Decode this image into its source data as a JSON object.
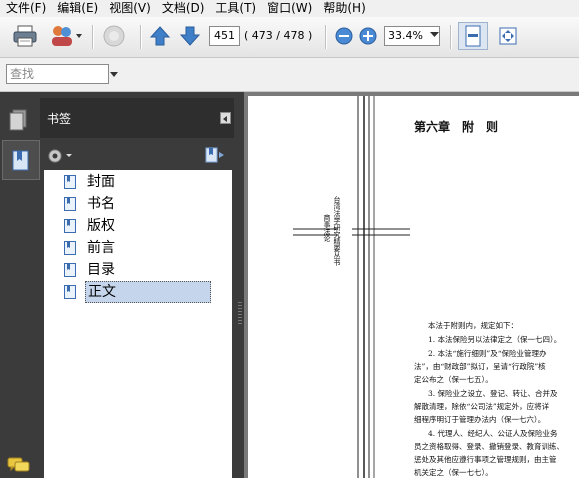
{
  "menu": [
    "文件(F)",
    "编辑(E)",
    "视图(V)",
    "文档(D)",
    "工具(T)",
    "窗口(W)",
    "帮助(H)"
  ],
  "toolbar": {
    "current_page": "451",
    "page_count": "( 473 / 478 )",
    "zoom": "33.4%"
  },
  "find": {
    "placeholder": "查找"
  },
  "sidebar": {
    "title": "书签",
    "bookmarks": [
      {
        "label": "封面"
      },
      {
        "label": "书名"
      },
      {
        "label": "版权"
      },
      {
        "label": "前言"
      },
      {
        "label": "目录"
      },
      {
        "label": "正文",
        "selected": true
      }
    ]
  },
  "document": {
    "chapter_title": "第六章　附　则",
    "side_title": "台湾法学研究精要丛书",
    "side_subtitle": "商事法论",
    "intro": "本法于附则内，规定如下：",
    "paragraphs": [
      "1. 本法保险另以法律定之（保一七四）。",
      "2. 本法“施行细则”及“保险业管理办",
      "法”，由“财政部”拟订，呈请“行政院”核",
      "定公布之（保一七五）。",
      "3. 保险业之设立、登记、转让、合并及",
      "解散清理，除依“公司法”规定外，应将详",
      "细程序明订于管理办法内（保一七六）。",
      "4. 代理人、经纪人、公证人及保险业务",
      "员之资格取得、登录、撤销登录、教育训练、",
      "惩处及其他应遵行事项之管理规则，由主管",
      "机关定之（保一七七）。"
    ]
  }
}
